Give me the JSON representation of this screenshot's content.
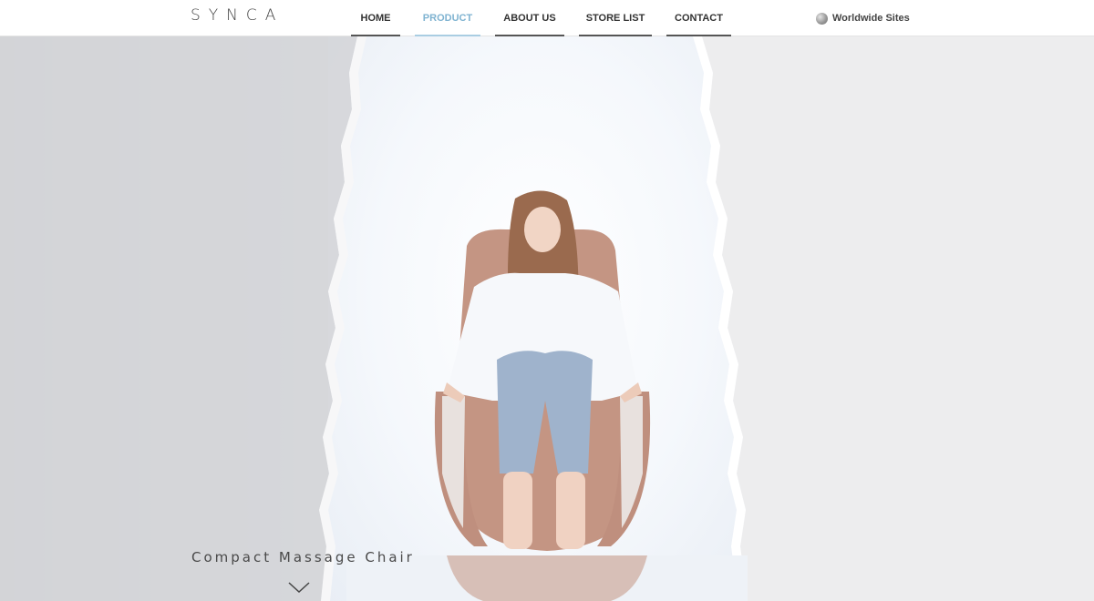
{
  "header": {
    "logo": "SYNCA",
    "nav": [
      {
        "label": "HOME",
        "active": false
      },
      {
        "label": "PRODUCT",
        "active": true
      },
      {
        "label": "ABOUT US",
        "active": false
      },
      {
        "label": "STORE LIST",
        "active": false
      },
      {
        "label": "CONTACT",
        "active": false
      }
    ],
    "worldwide": {
      "label": "Worldwide Sites",
      "icon": "globe-icon"
    }
  },
  "hero": {
    "tagline": "Compact Massage Chair",
    "scroll_icon": "chevron-down-icon"
  },
  "colors": {
    "accent": "#7fb3d1",
    "nav_bar": "#555555",
    "chair": "#c99a86",
    "text": "#333333"
  }
}
